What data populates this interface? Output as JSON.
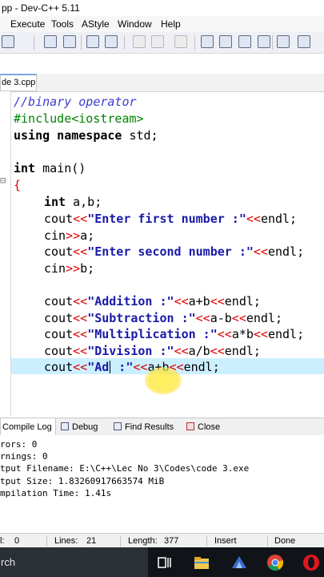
{
  "window": {
    "title": "pp - Dev-C++ 5.11"
  },
  "menu": [
    "Execute",
    "Tools",
    "AStyle",
    "Window",
    "Help"
  ],
  "file_tab": {
    "label": "de 3.cpp"
  },
  "code": {
    "lines": {
      "l1": "//binary operator",
      "l2": "#include<iostream>",
      "l3_kw": "using namespace",
      "l3_rest": " std;",
      "l5_kw": "int",
      "l5_rest": " main()",
      "l6": "{",
      "l7_kw": "int",
      "l7_rest": " a,b;",
      "l8_a": "cout",
      "l8_op1": "<<",
      "l8_str": "\"Enter first number :\"",
      "l8_op2": "<<",
      "l8_end": "endl;",
      "l9_a": "cin",
      "l9_op": ">>",
      "l9_end": "a;",
      "l10_a": "cout",
      "l10_op1": "<<",
      "l10_str": "\"Enter second number :\"",
      "l10_op2": "<<",
      "l10_end": "endl;",
      "l11_a": "cin",
      "l11_op": ">>",
      "l11_end": "b;",
      "l13_a": "cout",
      "l13_op1": "<<",
      "l13_str": "\"Addition :\"",
      "l13_op2": "<<",
      "l13_mid": "a+b",
      "l13_op3": "<<",
      "l13_end": "endl;",
      "l14_a": "cout",
      "l14_op1": "<<",
      "l14_str": "\"Subtraction :\"",
      "l14_op2": "<<",
      "l14_mid": "a-b",
      "l14_op3": "<<",
      "l14_end": "endl;",
      "l15_a": "cout",
      "l15_op1": "<<",
      "l15_str": "\"Multiplication :\"",
      "l15_op2": "<<",
      "l15_mid": "a*b",
      "l15_op3": "<<",
      "l15_end": "endl;",
      "l16_a": "cout",
      "l16_op1": "<<",
      "l16_str": "\"Division :\"",
      "l16_op2": "<<",
      "l16_mid": "a/b",
      "l16_op3": "<<",
      "l16_end": "endl;",
      "l17_a": "cout",
      "l17_op1": "<<",
      "l17_str_a": "\"Ad",
      "l17_str_b": " :\"",
      "l17_op2": "<<",
      "l17_mid": "a+b",
      "l17_op3": "<<",
      "l17_end": "endl;"
    }
  },
  "bottom_tabs": [
    "Compile Log",
    "Debug",
    "Find Results",
    "Close"
  ],
  "compile_log": [
    "rors: 0",
    "rnings: 0",
    "tput Filename: E:\\C++\\Lec No 3\\Codes\\code 3.exe",
    "tput Size: 1.83260917663574 MiB",
    "mpilation Time: 1.41s"
  ],
  "status": {
    "col": "l:",
    "col_val": "0",
    "lines_label": "Lines:",
    "lines_val": "21",
    "length_label": "Length:",
    "length_val": "377",
    "mode": "Insert",
    "message": "Done parsing"
  },
  "taskbar": {
    "search_text": "rch"
  },
  "colors": {
    "current_line": "#ccefff",
    "string": "#1a1aa8",
    "operator": "#e00000",
    "comment": "#3b3bd0",
    "preprocessor": "#008000"
  }
}
